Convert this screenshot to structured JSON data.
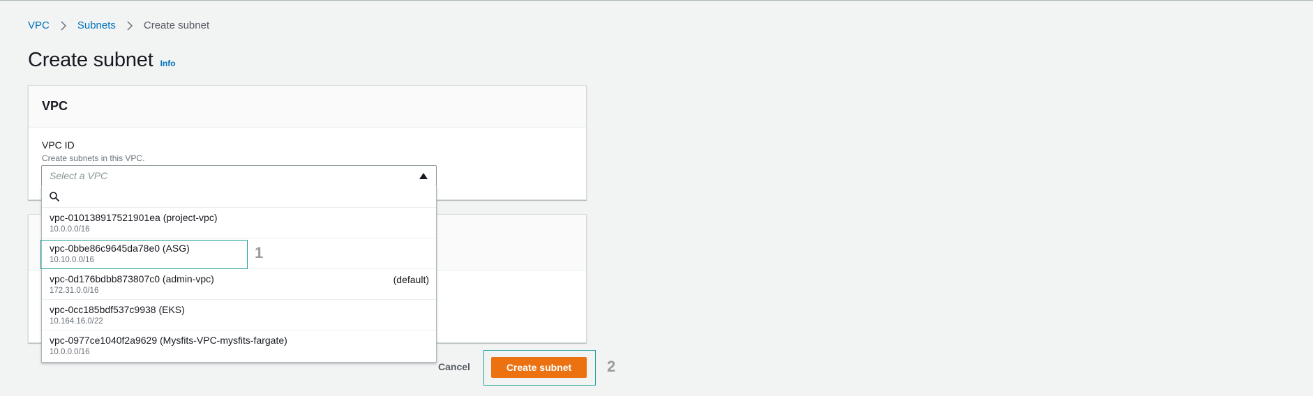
{
  "breadcrumb": {
    "items": [
      "VPC",
      "Subnets"
    ],
    "current": "Create subnet"
  },
  "page": {
    "title": "Create subnet",
    "info_link": "Info"
  },
  "vpc_panel": {
    "title": "VPC",
    "field_label": "VPC ID",
    "field_description": "Create subnets in this VPC.",
    "select_placeholder": "Select a VPC"
  },
  "dropdown": {
    "search_value": "",
    "options": [
      {
        "name": "vpc-010138917521901ea (project-vpc)",
        "cidr": "10.0.0.0/16",
        "tag": ""
      },
      {
        "name": "vpc-0bbe86c9645da78e0 (ASG)",
        "cidr": "10.10.0.0/16",
        "tag": ""
      },
      {
        "name": "vpc-0d176bdbb873807c0 (admin-vpc)",
        "cidr": "172.31.0.0/16",
        "tag": "(default)"
      },
      {
        "name": "vpc-0cc185bdf537c9938 (EKS)",
        "cidr": "10.164.16.0/22",
        "tag": ""
      },
      {
        "name": "vpc-0977ce1040f2a9629 (Mysfits-VPC-mysfits-fargate)",
        "cidr": "10.0.0.0/16",
        "tag": ""
      }
    ]
  },
  "annotations": {
    "marker1": "1",
    "marker2": "2"
  },
  "footer": {
    "cancel_label": "Cancel",
    "create_label": "Create subnet"
  },
  "colors": {
    "link": "#0073bb",
    "primary_button": "#ec7211",
    "highlight": "#1aa197"
  },
  "icons": {
    "breadcrumb_separator": "chevron-right-icon",
    "select_caret": "caret-up-icon",
    "search": "search-icon"
  }
}
